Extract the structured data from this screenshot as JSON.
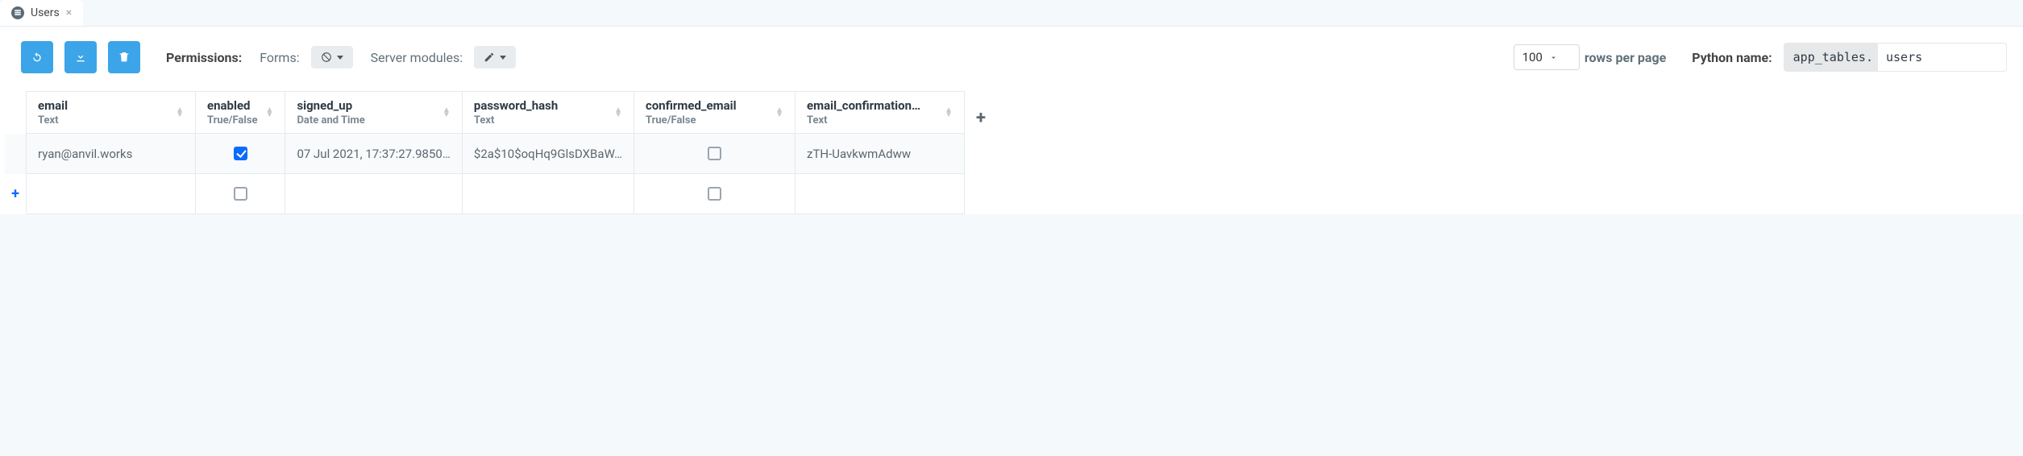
{
  "tab": {
    "title": "Users"
  },
  "toolbar": {
    "permissions_label": "Permissions:",
    "forms_label": "Forms:",
    "server_label": "Server modules:"
  },
  "pagination": {
    "value": "100",
    "label": "rows per page"
  },
  "python_name": {
    "label": "Python name:",
    "prefix": "app_tables.",
    "value": "users"
  },
  "columns": [
    {
      "name": "email",
      "type": "Text"
    },
    {
      "name": "enabled",
      "type": "True/False"
    },
    {
      "name": "signed_up",
      "type": "Date and Time"
    },
    {
      "name": "password_hash",
      "type": "Text"
    },
    {
      "name": "confirmed_email",
      "type": "True/False"
    },
    {
      "name": "email_confirmation…",
      "type": "Text"
    }
  ],
  "rows": [
    {
      "email": "ryan@anvil.works",
      "enabled": true,
      "signed_up": "07 Jul 2021, 17:37:27.9850…",
      "password_hash": "$2a$10$oqHq9GlsDXBaW…",
      "confirmed_email": false,
      "email_confirmation": "zTH-UavkwmAdww"
    }
  ]
}
